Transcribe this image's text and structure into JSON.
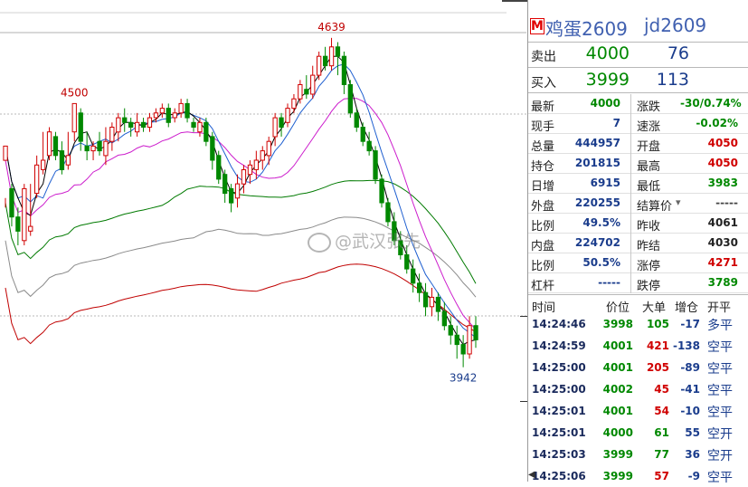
{
  "watermark": "@武汉张先",
  "contract": {
    "name": "鸡蛋2609",
    "code": "jd2609",
    "badge": "M"
  },
  "quote": {
    "ask": {
      "label": "卖出",
      "price": "4000",
      "volume": "76"
    },
    "bid": {
      "label": "买入",
      "price": "3999",
      "volume": "113"
    }
  },
  "stats": [
    {
      "l1": "最新",
      "v1": "4000",
      "c1": "#008800",
      "l2": "涨跌",
      "v2": "-30/0.74%",
      "c2": "#008800"
    },
    {
      "l1": "现手",
      "v1": "7",
      "c1": "#1a3c8c",
      "l2": "速涨",
      "v2": "-0.02%",
      "c2": "#008800"
    },
    {
      "l1": "总量",
      "v1": "444957",
      "c1": "#1a3c8c",
      "l2": "开盘",
      "v2": "4050",
      "c2": "#d00000"
    },
    {
      "l1": "持仓",
      "v1": "201815",
      "c1": "#1a3c8c",
      "l2": "最高",
      "v2": "4050",
      "c2": "#d00000"
    },
    {
      "l1": "日增",
      "v1": "6915",
      "c1": "#1a3c8c",
      "l2": "最低",
      "v2": "3983",
      "c2": "#008800"
    },
    {
      "l1": "外盘",
      "v1": "220255",
      "c1": "#1a3c8c",
      "l2": "结算价",
      "v2": "-----",
      "c2": "#444444"
    },
    {
      "l1": "比例",
      "v1": "49.5%",
      "c1": "#1a3c8c",
      "l2": "昨收",
      "v2": "4061",
      "c2": "#222222"
    },
    {
      "l1": "内盘",
      "v1": "224702",
      "c1": "#1a3c8c",
      "l2": "昨结",
      "v2": "4030",
      "c2": "#222222"
    },
    {
      "l1": "比例",
      "v1": "50.5%",
      "c1": "#1a3c8c",
      "l2": "涨停",
      "v2": "4271",
      "c2": "#d00000"
    },
    {
      "l1": "杠杆",
      "v1": "-----",
      "c1": "#1a3c8c",
      "l2": "跌停",
      "v2": "3789",
      "c2": "#008800"
    }
  ],
  "ticks_header": {
    "time": "时间",
    "price": "价位",
    "big": "大单",
    "oi": "增仓",
    "type": "开平"
  },
  "ticks": [
    {
      "time": "14:24:46",
      "price": "3998",
      "pc": "#008800",
      "vol": "105",
      "vc": "#008800",
      "oi": "-17",
      "dir": "多平"
    },
    {
      "time": "14:24:59",
      "price": "4001",
      "pc": "#008800",
      "vol": "421",
      "vc": "#d00000",
      "oi": "-138",
      "dir": "空平"
    },
    {
      "time": "14:25:00",
      "price": "4001",
      "pc": "#008800",
      "vol": "205",
      "vc": "#d00000",
      "oi": "-89",
      "dir": "空平"
    },
    {
      "time": "14:25:00",
      "price": "4002",
      "pc": "#008800",
      "vol": "45",
      "vc": "#d00000",
      "oi": "-41",
      "dir": "空平"
    },
    {
      "time": "14:25:01",
      "price": "4001",
      "pc": "#008800",
      "vol": "54",
      "vc": "#d00000",
      "oi": "-10",
      "dir": "空平"
    },
    {
      "time": "14:25:01",
      "price": "4000",
      "pc": "#008800",
      "vol": "61",
      "vc": "#008800",
      "oi": "55",
      "dir": "空开"
    },
    {
      "time": "14:25:03",
      "price": "3999",
      "pc": "#008800",
      "vol": "77",
      "vc": "#008800",
      "oi": "36",
      "dir": "空开"
    },
    {
      "time": "14:25:06",
      "price": "3999",
      "pc": "#008800",
      "vol": "57",
      "vc": "#d00000",
      "oi": "-9",
      "dir": "空平"
    }
  ],
  "chart_data": {
    "type": "candlestick",
    "annotations": [
      {
        "text": "4500"
      },
      {
        "text": "4639"
      },
      {
        "text": "3942"
      }
    ],
    "candles": [
      [
        4380,
        4410,
        4300,
        4280
      ],
      [
        4320,
        4260,
        4330,
        4240
      ],
      [
        4260,
        4230,
        4280,
        4200
      ],
      [
        4210,
        4320,
        4330,
        4200
      ],
      [
        4230,
        4240,
        4330,
        4220
      ],
      [
        4310,
        4370,
        4390,
        4300
      ],
      [
        4360,
        4380,
        4440,
        4350
      ],
      [
        4390,
        4440,
        4450,
        4380
      ],
      [
        4430,
        4390,
        4440,
        4380
      ],
      [
        4400,
        4360,
        4420,
        4350
      ],
      [
        4370,
        4390,
        4440,
        4360
      ],
      [
        4440,
        4500,
        4500,
        4420
      ],
      [
        4480,
        4420,
        4490,
        4400
      ],
      [
        4410,
        4400,
        4440,
        4380
      ],
      [
        4400,
        4410,
        4420,
        4380
      ],
      [
        4420,
        4400,
        4440,
        4390
      ],
      [
        4390,
        4420,
        4450,
        4370
      ],
      [
        4420,
        4450,
        4460,
        4400
      ],
      [
        4440,
        4470,
        4480,
        4420
      ],
      [
        4470,
        4460,
        4490,
        4440
      ],
      [
        4460,
        4450,
        4470,
        4430
      ],
      [
        4440,
        4460,
        4480,
        4430
      ],
      [
        4460,
        4450,
        4470,
        4440
      ],
      [
        4450,
        4470,
        4480,
        4440
      ],
      [
        4470,
        4480,
        4490,
        4460
      ],
      [
        4480,
        4490,
        4500,
        4470
      ],
      [
        4490,
        4460,
        4500,
        4450
      ],
      [
        4470,
        4480,
        4490,
        4460
      ],
      [
        4480,
        4500,
        4510,
        4470
      ],
      [
        4500,
        4470,
        4510,
        4460
      ],
      [
        4460,
        4450,
        4470,
        4440
      ],
      [
        4440,
        4460,
        4470,
        4430
      ],
      [
        4460,
        4420,
        4470,
        4410
      ],
      [
        4430,
        4380,
        4440,
        4360
      ],
      [
        4390,
        4340,
        4400,
        4330
      ],
      [
        4350,
        4310,
        4360,
        4290
      ],
      [
        4320,
        4290,
        4330,
        4270
      ],
      [
        4300,
        4330,
        4350,
        4280
      ],
      [
        4330,
        4360,
        4370,
        4310
      ],
      [
        4350,
        4370,
        4380,
        4330
      ],
      [
        4360,
        4380,
        4400,
        4340
      ],
      [
        4380,
        4400,
        4410,
        4360
      ],
      [
        4390,
        4420,
        4430,
        4370
      ],
      [
        4430,
        4470,
        4480,
        4410
      ],
      [
        4470,
        4450,
        4480,
        4430
      ],
      [
        4460,
        4490,
        4500,
        4450
      ],
      [
        4490,
        4510,
        4520,
        4480
      ],
      [
        4510,
        4540,
        4550,
        4500
      ],
      [
        4530,
        4520,
        4560,
        4510
      ],
      [
        4520,
        4560,
        4580,
        4510
      ],
      [
        4560,
        4600,
        4610,
        4550
      ],
      [
        4600,
        4580,
        4620,
        4570
      ],
      [
        4580,
        4620,
        4639,
        4570
      ],
      [
        4620,
        4600,
        4630,
        4560
      ],
      [
        4600,
        4540,
        4610,
        4520
      ],
      [
        4540,
        4480,
        4550,
        4470
      ],
      [
        4480,
        4450,
        4490,
        4440
      ],
      [
        4450,
        4420,
        4460,
        4410
      ],
      [
        4420,
        4400,
        4440,
        4390
      ],
      [
        4400,
        4340,
        4410,
        4330
      ],
      [
        4340,
        4290,
        4350,
        4280
      ],
      [
        4290,
        4250,
        4300,
        4240
      ],
      [
        4250,
        4210,
        4270,
        4200
      ],
      [
        4210,
        4180,
        4230,
        4170
      ],
      [
        4180,
        4150,
        4200,
        4140
      ],
      [
        4150,
        4120,
        4170,
        4100
      ],
      [
        4120,
        4100,
        4140,
        4080
      ],
      [
        4100,
        4070,
        4120,
        4050
      ],
      [
        4070,
        4090,
        4110,
        4050
      ],
      [
        4090,
        4060,
        4100,
        4040
      ],
      [
        4060,
        4030,
        4080,
        4020
      ],
      [
        4030,
        4010,
        4050,
        3990
      ],
      [
        4010,
        3990,
        4030,
        3960
      ],
      [
        3990,
        3970,
        4010,
        3942
      ],
      [
        3970,
        4030,
        4050,
        3960
      ],
      [
        4030,
        4000,
        4050,
        3983
      ]
    ],
    "ma5_color": "#000000",
    "ma10_color": "#1f5fd0",
    "ma20_color": "#cc1ccc",
    "ma60_color": "#007a00",
    "ma120_color": "#8a8a8a",
    "ma250_color": "#c00000",
    "grid": "dashed horizontal",
    "up_color": "#d00000",
    "down_color": "#008800"
  }
}
